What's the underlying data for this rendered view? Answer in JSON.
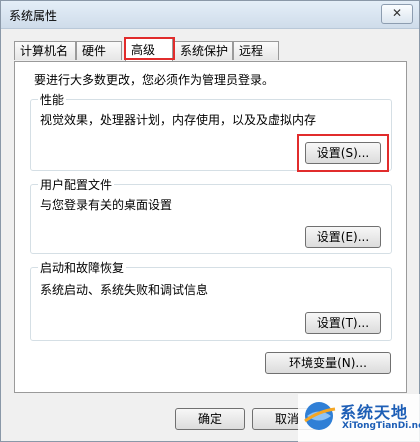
{
  "window": {
    "title": "系统属性",
    "close_glyph": "✕"
  },
  "tabs": [
    {
      "label": "计算机名"
    },
    {
      "label": "硬件"
    },
    {
      "label": "高级",
      "active": true
    },
    {
      "label": "系统保护"
    },
    {
      "label": "远程"
    }
  ],
  "admin_note": "要进行大多数更改，您必须作为管理员登录。",
  "performance": {
    "title": "性能",
    "desc": "视觉效果，处理器计划，内存使用，以及及虚拟内存",
    "button": "设置(S)..."
  },
  "user_profiles": {
    "title": "用户配置文件",
    "desc": "与您登录有关的桌面设置",
    "button": "设置(E)..."
  },
  "startup_recovery": {
    "title": "启动和故障恢复",
    "desc": "系统启动、系统失败和调试信息",
    "button": "设置(T)..."
  },
  "env_button": "环境变量(N)...",
  "footer": {
    "ok": "确定",
    "cancel": "取消"
  },
  "watermark": {
    "title": "系统天地",
    "subtitle": "XiTongTianDi.net"
  },
  "colors": {
    "highlight": "#e12c2c",
    "brand": "#1d5eb6"
  }
}
